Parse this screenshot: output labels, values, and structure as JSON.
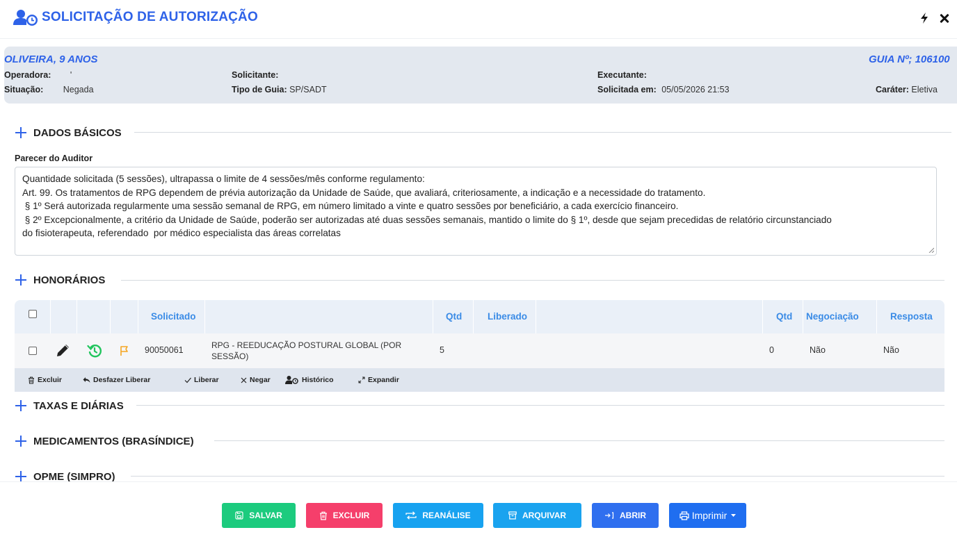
{
  "header": {
    "title": "SOLICITAÇÃO DE AUTORIZAÇÃO",
    "title_icon": "user-clock-icon",
    "flash_icon": "lightning-icon",
    "close_icon": "close-icon",
    "accent": "#2e62e8"
  },
  "patient": {
    "name": "OLIVEIRA, 9 ANOS",
    "guia": "GUIA Nº; 106100",
    "operadora_label": "Operadora:",
    "operadora_value": "'",
    "situacao_label": "Situação:",
    "situacao_value": "Negada",
    "solicitante_label": "Solicitante:",
    "solicitante_value": "",
    "tipo_guia_label": "Tipo de Guia:",
    "tipo_guia_value": "SP/SADT",
    "executante_label": "Executante:",
    "executante_value": "",
    "solicitada_label": "Solicitada em:",
    "solicitada_value": "05/05/2026 21:53",
    "carater_label": "Caráter:",
    "carater_value": "Eletiva"
  },
  "sections": {
    "dados_basicos": "DADOS BÁSICOS",
    "honorarios": "HONORÁRIOS",
    "taxas": "TAXAS E DIÁRIAS",
    "medicamentos": "MEDICAMENTOS (BRASÍNDICE)",
    "opme": "OPME (SIMPRO)"
  },
  "parecer": {
    "label": "Parecer do Auditor",
    "lines": [
      "Quantidade solicitada (5 sessões), ultrapassa o limite de 4 sessões/mês conforme regulamento:",
      "Art. 99. Os tratamentos de RPG dependem de prévia autorização da Unidade de Saúde, que avaliará, criteriosamente, a indicação e a necessidade do tratamento.",
      " § 1º Será autorizada regularmente uma sessão semanal de RPG, em número limitado a vinte e quatro sessões por beneficiário, a cada exercício financeiro.",
      " § 2º Excepcionalmente, a critério da Unidade de Saúde, poderão ser autorizadas até duas sessões semanais, mantido o limite do § 1º, desde que sejam precedidas de relatório circunstanciado",
      "do fisioterapeuta, referendado  por médico especialista das áreas correlatas"
    ]
  },
  "honorarios_table": {
    "headers": {
      "solicitado": "Solicitado",
      "qtd1": "Qtd",
      "liberado": "Liberado",
      "qtd2": "Qtd",
      "negociacao": "Negociação",
      "resposta": "Resposta"
    },
    "rows": [
      {
        "codigo": "90050061",
        "descricao_l1": "RPG - REEDUCAÇÃO POSTURAL GLOBAL (POR",
        "descricao_l2": "SESSÃO)",
        "qtd": "5",
        "liberado": "",
        "qtd_liberado": "0",
        "negociacao": "Não",
        "resposta": "Não"
      }
    ],
    "row_icons": [
      "pencil-icon",
      "history-icon",
      "flag-icon"
    ],
    "icon_colors": {
      "history": "#22c55e",
      "flag": "#f5a623"
    }
  },
  "actions": {
    "excluir": "Excluir",
    "desfazer": "Desfazer Liberar",
    "liberar": "Liberar",
    "negar": "Negar",
    "historico": "Histórico",
    "expandir": "Expandir"
  },
  "footer_buttons": {
    "salvar": {
      "label": "SALVAR",
      "color": "#1ccb7e",
      "icon": "save-icon"
    },
    "excluir": {
      "label": "EXCLUIR",
      "color": "#f53f6b",
      "icon": "trash-icon"
    },
    "reanalise": {
      "label": "REANÁLISE",
      "color": "#17a2f0",
      "icon": "repeat-icon"
    },
    "arquivar": {
      "label": "ARQUIVAR",
      "color": "#1aa3ef",
      "icon": "archive-icon"
    },
    "abrir": {
      "label": "ABRIR",
      "color": "#2f6fef",
      "icon": "login-icon"
    },
    "imprimir": {
      "label": "Imprimir",
      "color": "#1f6ef0",
      "icon": "printer-icon"
    }
  }
}
